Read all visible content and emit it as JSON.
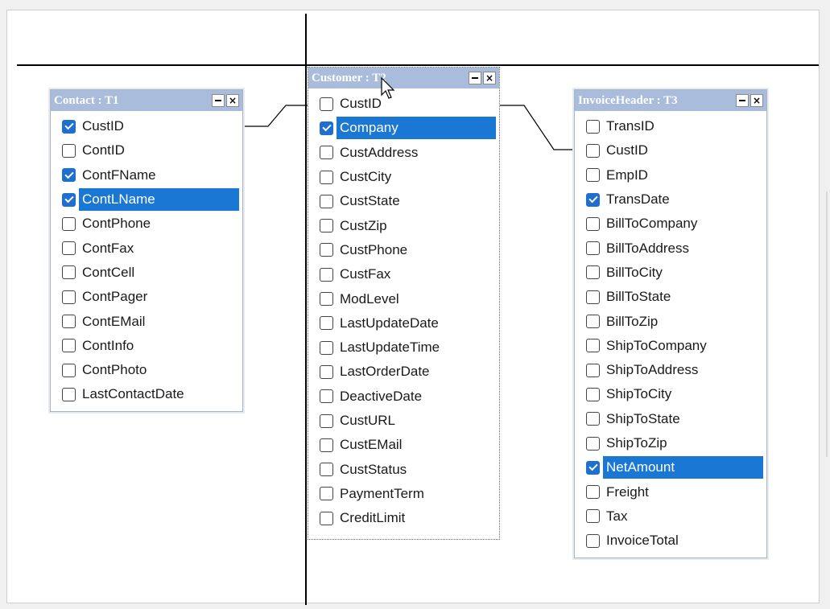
{
  "tables": [
    {
      "title": "Contact : T1",
      "columns": [
        {
          "label": "CustID",
          "checked": true,
          "highlighted": false
        },
        {
          "label": "ContID",
          "checked": false,
          "highlighted": false
        },
        {
          "label": "ContFName",
          "checked": true,
          "highlighted": false
        },
        {
          "label": "ContLName",
          "checked": true,
          "highlighted": true
        },
        {
          "label": "ContPhone",
          "checked": false,
          "highlighted": false
        },
        {
          "label": "ContFax",
          "checked": false,
          "highlighted": false
        },
        {
          "label": "ContCell",
          "checked": false,
          "highlighted": false
        },
        {
          "label": "ContPager",
          "checked": false,
          "highlighted": false
        },
        {
          "label": "ContEMail",
          "checked": false,
          "highlighted": false
        },
        {
          "label": "ContInfo",
          "checked": false,
          "highlighted": false
        },
        {
          "label": "ContPhoto",
          "checked": false,
          "highlighted": false
        },
        {
          "label": "LastContactDate",
          "checked": false,
          "highlighted": false
        }
      ]
    },
    {
      "title": "Customer : T2",
      "columns": [
        {
          "label": "CustID",
          "checked": false,
          "highlighted": false
        },
        {
          "label": "Company",
          "checked": true,
          "highlighted": true
        },
        {
          "label": "CustAddress",
          "checked": false,
          "highlighted": false
        },
        {
          "label": "CustCity",
          "checked": false,
          "highlighted": false
        },
        {
          "label": "CustState",
          "checked": false,
          "highlighted": false
        },
        {
          "label": "CustZip",
          "checked": false,
          "highlighted": false
        },
        {
          "label": "CustPhone",
          "checked": false,
          "highlighted": false
        },
        {
          "label": "CustFax",
          "checked": false,
          "highlighted": false
        },
        {
          "label": "ModLevel",
          "checked": false,
          "highlighted": false
        },
        {
          "label": "LastUpdateDate",
          "checked": false,
          "highlighted": false
        },
        {
          "label": "LastUpdateTime",
          "checked": false,
          "highlighted": false
        },
        {
          "label": "LastOrderDate",
          "checked": false,
          "highlighted": false
        },
        {
          "label": "DeactiveDate",
          "checked": false,
          "highlighted": false
        },
        {
          "label": "CustURL",
          "checked": false,
          "highlighted": false
        },
        {
          "label": "CustEMail",
          "checked": false,
          "highlighted": false
        },
        {
          "label": "CustStatus",
          "checked": false,
          "highlighted": false
        },
        {
          "label": "PaymentTerm",
          "checked": false,
          "highlighted": false
        },
        {
          "label": "CreditLimit",
          "checked": false,
          "highlighted": false
        }
      ]
    },
    {
      "title": "InvoiceHeader : T3",
      "columns": [
        {
          "label": "TransID",
          "checked": false,
          "highlighted": false
        },
        {
          "label": "CustID",
          "checked": false,
          "highlighted": false
        },
        {
          "label": "EmpID",
          "checked": false,
          "highlighted": false
        },
        {
          "label": "TransDate",
          "checked": true,
          "highlighted": false
        },
        {
          "label": "BillToCompany",
          "checked": false,
          "highlighted": false
        },
        {
          "label": "BillToAddress",
          "checked": false,
          "highlighted": false
        },
        {
          "label": "BillToCity",
          "checked": false,
          "highlighted": false
        },
        {
          "label": "BillToState",
          "checked": false,
          "highlighted": false
        },
        {
          "label": "BillToZip",
          "checked": false,
          "highlighted": false
        },
        {
          "label": "ShipToCompany",
          "checked": false,
          "highlighted": false
        },
        {
          "label": "ShipToAddress",
          "checked": false,
          "highlighted": false
        },
        {
          "label": "ShipToCity",
          "checked": false,
          "highlighted": false
        },
        {
          "label": "ShipToState",
          "checked": false,
          "highlighted": false
        },
        {
          "label": "ShipToZip",
          "checked": false,
          "highlighted": false
        },
        {
          "label": "NetAmount",
          "checked": true,
          "highlighted": true
        },
        {
          "label": "Freight",
          "checked": false,
          "highlighted": false
        },
        {
          "label": "Tax",
          "checked": false,
          "highlighted": false
        },
        {
          "label": "InvoiceTotal",
          "checked": false,
          "highlighted": false
        }
      ]
    }
  ],
  "icons": {
    "minimize": "minimize-icon",
    "close": "close-icon",
    "cursor": "arrow-cursor-icon"
  },
  "colors": {
    "header": "#a9bcdb",
    "highlight": "#1a78d4",
    "checkbox": "#1e6fd1"
  }
}
